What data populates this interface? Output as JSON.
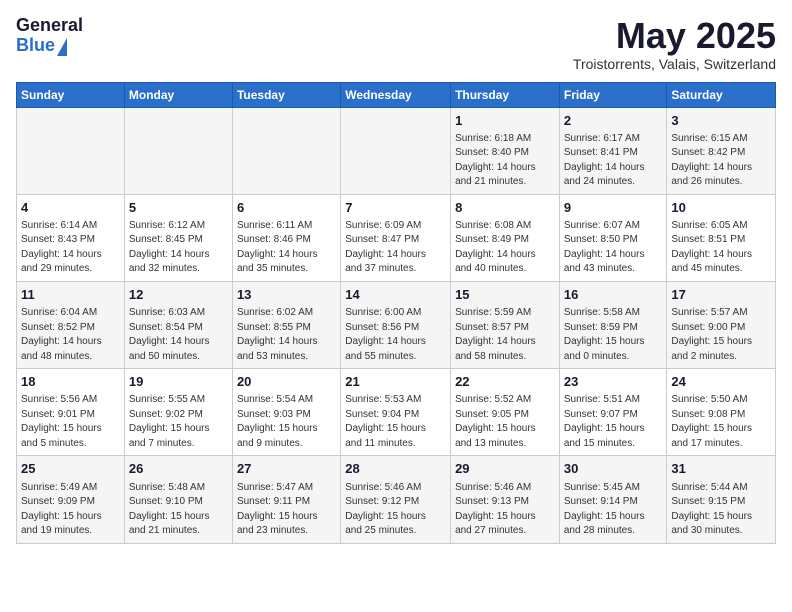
{
  "header": {
    "logo_general": "General",
    "logo_blue": "Blue",
    "month_title": "May 2025",
    "location": "Troistorrents, Valais, Switzerland"
  },
  "days_of_week": [
    "Sunday",
    "Monday",
    "Tuesday",
    "Wednesday",
    "Thursday",
    "Friday",
    "Saturday"
  ],
  "weeks": [
    [
      {
        "day": "",
        "info": ""
      },
      {
        "day": "",
        "info": ""
      },
      {
        "day": "",
        "info": ""
      },
      {
        "day": "",
        "info": ""
      },
      {
        "day": "1",
        "info": "Sunrise: 6:18 AM\nSunset: 8:40 PM\nDaylight: 14 hours\nand 21 minutes."
      },
      {
        "day": "2",
        "info": "Sunrise: 6:17 AM\nSunset: 8:41 PM\nDaylight: 14 hours\nand 24 minutes."
      },
      {
        "day": "3",
        "info": "Sunrise: 6:15 AM\nSunset: 8:42 PM\nDaylight: 14 hours\nand 26 minutes."
      }
    ],
    [
      {
        "day": "4",
        "info": "Sunrise: 6:14 AM\nSunset: 8:43 PM\nDaylight: 14 hours\nand 29 minutes."
      },
      {
        "day": "5",
        "info": "Sunrise: 6:12 AM\nSunset: 8:45 PM\nDaylight: 14 hours\nand 32 minutes."
      },
      {
        "day": "6",
        "info": "Sunrise: 6:11 AM\nSunset: 8:46 PM\nDaylight: 14 hours\nand 35 minutes."
      },
      {
        "day": "7",
        "info": "Sunrise: 6:09 AM\nSunset: 8:47 PM\nDaylight: 14 hours\nand 37 minutes."
      },
      {
        "day": "8",
        "info": "Sunrise: 6:08 AM\nSunset: 8:49 PM\nDaylight: 14 hours\nand 40 minutes."
      },
      {
        "day": "9",
        "info": "Sunrise: 6:07 AM\nSunset: 8:50 PM\nDaylight: 14 hours\nand 43 minutes."
      },
      {
        "day": "10",
        "info": "Sunrise: 6:05 AM\nSunset: 8:51 PM\nDaylight: 14 hours\nand 45 minutes."
      }
    ],
    [
      {
        "day": "11",
        "info": "Sunrise: 6:04 AM\nSunset: 8:52 PM\nDaylight: 14 hours\nand 48 minutes."
      },
      {
        "day": "12",
        "info": "Sunrise: 6:03 AM\nSunset: 8:54 PM\nDaylight: 14 hours\nand 50 minutes."
      },
      {
        "day": "13",
        "info": "Sunrise: 6:02 AM\nSunset: 8:55 PM\nDaylight: 14 hours\nand 53 minutes."
      },
      {
        "day": "14",
        "info": "Sunrise: 6:00 AM\nSunset: 8:56 PM\nDaylight: 14 hours\nand 55 minutes."
      },
      {
        "day": "15",
        "info": "Sunrise: 5:59 AM\nSunset: 8:57 PM\nDaylight: 14 hours\nand 58 minutes."
      },
      {
        "day": "16",
        "info": "Sunrise: 5:58 AM\nSunset: 8:59 PM\nDaylight: 15 hours\nand 0 minutes."
      },
      {
        "day": "17",
        "info": "Sunrise: 5:57 AM\nSunset: 9:00 PM\nDaylight: 15 hours\nand 2 minutes."
      }
    ],
    [
      {
        "day": "18",
        "info": "Sunrise: 5:56 AM\nSunset: 9:01 PM\nDaylight: 15 hours\nand 5 minutes."
      },
      {
        "day": "19",
        "info": "Sunrise: 5:55 AM\nSunset: 9:02 PM\nDaylight: 15 hours\nand 7 minutes."
      },
      {
        "day": "20",
        "info": "Sunrise: 5:54 AM\nSunset: 9:03 PM\nDaylight: 15 hours\nand 9 minutes."
      },
      {
        "day": "21",
        "info": "Sunrise: 5:53 AM\nSunset: 9:04 PM\nDaylight: 15 hours\nand 11 minutes."
      },
      {
        "day": "22",
        "info": "Sunrise: 5:52 AM\nSunset: 9:05 PM\nDaylight: 15 hours\nand 13 minutes."
      },
      {
        "day": "23",
        "info": "Sunrise: 5:51 AM\nSunset: 9:07 PM\nDaylight: 15 hours\nand 15 minutes."
      },
      {
        "day": "24",
        "info": "Sunrise: 5:50 AM\nSunset: 9:08 PM\nDaylight: 15 hours\nand 17 minutes."
      }
    ],
    [
      {
        "day": "25",
        "info": "Sunrise: 5:49 AM\nSunset: 9:09 PM\nDaylight: 15 hours\nand 19 minutes."
      },
      {
        "day": "26",
        "info": "Sunrise: 5:48 AM\nSunset: 9:10 PM\nDaylight: 15 hours\nand 21 minutes."
      },
      {
        "day": "27",
        "info": "Sunrise: 5:47 AM\nSunset: 9:11 PM\nDaylight: 15 hours\nand 23 minutes."
      },
      {
        "day": "28",
        "info": "Sunrise: 5:46 AM\nSunset: 9:12 PM\nDaylight: 15 hours\nand 25 minutes."
      },
      {
        "day": "29",
        "info": "Sunrise: 5:46 AM\nSunset: 9:13 PM\nDaylight: 15 hours\nand 27 minutes."
      },
      {
        "day": "30",
        "info": "Sunrise: 5:45 AM\nSunset: 9:14 PM\nDaylight: 15 hours\nand 28 minutes."
      },
      {
        "day": "31",
        "info": "Sunrise: 5:44 AM\nSunset: 9:15 PM\nDaylight: 15 hours\nand 30 minutes."
      }
    ]
  ]
}
